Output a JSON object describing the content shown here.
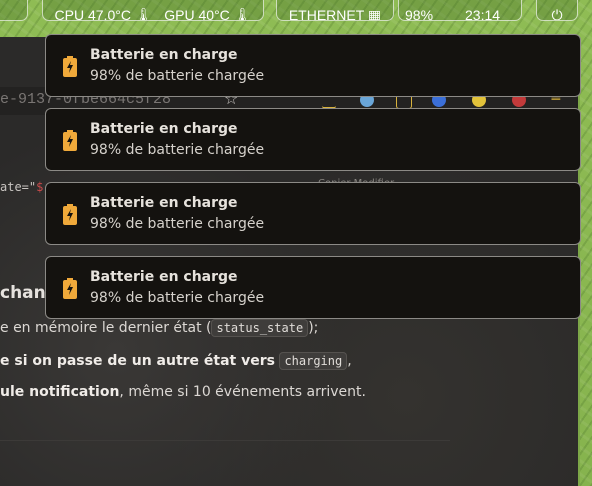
{
  "topbar": {
    "cpu": "CPU 47.0°C",
    "gpu": "GPU 40°C",
    "ethernet": "ETHERNET",
    "battery": "98%",
    "clock": "23:14",
    "power_icon": "power-icon"
  },
  "browser": {
    "url_fragment": "e-9137-0fbe664c5f28",
    "code_prefix": "ate=\"",
    "code_str": "$",
    "faint_text": "Copier   Modifier",
    "heading": "chang",
    "line1_plain": "e en mémoire le dernier état (",
    "line1_code": "status_state",
    "line1_end": ");",
    "line2_bold": "e si on passe de un autre état vers",
    "line2_code": "charging",
    "line2_end": ",",
    "line3_bold": "ule notification",
    "line3_plain": ", même si 10 événements arrivent."
  },
  "notifications": [
    {
      "title": "Batterie en charge",
      "body": "98% de batterie chargée"
    },
    {
      "title": "Batterie en charge",
      "body": "98% de batterie chargée"
    },
    {
      "title": "Batterie en charge",
      "body": "98% de batterie chargée"
    },
    {
      "title": "Batterie en charge",
      "body": "98% de batterie chargée"
    }
  ],
  "colors": {
    "battery_icon": "#f0a93a",
    "accent_green": "#86b34e"
  }
}
